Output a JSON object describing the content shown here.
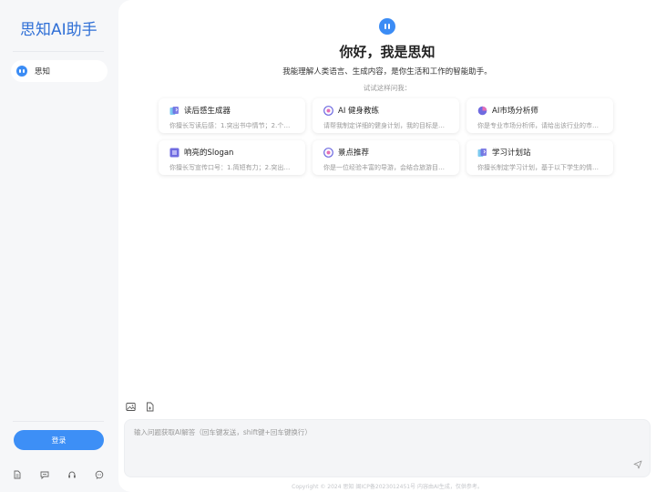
{
  "sidebar": {
    "brand": "思知AI助手",
    "chat_item": "思知",
    "login": "登录",
    "bottom_icons": [
      "document-icon",
      "chat-icon",
      "headset-icon",
      "message-icon"
    ]
  },
  "hero": {
    "title": "你好，我是思知",
    "subtitle": "我能理解人类语言、生成内容，是你生活和工作的智能助手。",
    "hint": "试试这样问我："
  },
  "cards": [
    {
      "title": "读后感生成器",
      "desc": "你擅长写读后感：1.突出书中情节；2.个人...",
      "icon": "book-icon"
    },
    {
      "title": "AI 健身教练",
      "desc": "请帮我制定详细的健身计划，我的目标是：...",
      "icon": "fitness-icon"
    },
    {
      "title": "AI市场分析师",
      "desc": "你是专业市场分析师，请给出该行业的市场...",
      "icon": "chart-icon"
    },
    {
      "title": "响亮的Slogan",
      "desc": "你擅长写宣传口号：1.简短有力；2.突出亮...",
      "icon": "slogan-icon"
    },
    {
      "title": "景点推荐",
      "desc": "你是一位经验丰富的导游，会结合旅游目的...",
      "icon": "map-icon"
    },
    {
      "title": "学习计划站",
      "desc": "你擅长制定学习计划，基于以下学生的情况...",
      "icon": "study-icon"
    }
  ],
  "input": {
    "placeholder": "输入问题获取AI解答（回车键发送，shift键+回车键换行）"
  },
  "footer": "Copyright © 2024 思知 闽ICP备2023012451号 内容由AI生成，仅供参考。",
  "colors": {
    "accent": "#3d8ff6",
    "brand": "#2f6fd6"
  }
}
